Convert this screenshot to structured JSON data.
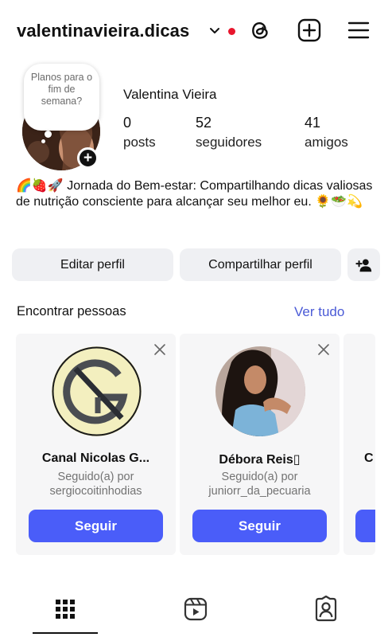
{
  "header": {
    "username": "valentinavieira.dicas",
    "icons": [
      "chevron-down-icon",
      "threads-icon",
      "new-post-icon",
      "menu-icon"
    ],
    "notification_dot_color": "#e8162d"
  },
  "profile": {
    "note": "Planos para o fim de semana?",
    "full_name": "Valentina Vieira",
    "stats": [
      {
        "value": "0",
        "label": "posts"
      },
      {
        "value": "52",
        "label": "seguidores"
      },
      {
        "value": "41",
        "label": "amigos"
      }
    ],
    "bio": "🌈🍓🚀 Jornada do Bem-estar: Compartilhando dicas valiosas de nutrição consciente para alcançar seu melhor eu. 🌻🥗💫"
  },
  "actions": {
    "edit_label": "Editar perfil",
    "share_label": "Compartilhar perfil"
  },
  "suggestions": {
    "title": "Encontrar pessoas",
    "see_all": "Ver tudo",
    "accent_color": "#4a5df9",
    "cards": [
      {
        "name": "Canal Nicolas G...",
        "followed_by_label": "Seguido(a) por",
        "followed_by_user": "sergiocoitinhodias",
        "button": "Seguir"
      },
      {
        "name": "Débora Reis▯",
        "followed_by_label": "Seguido(a) por",
        "followed_by_user": "juniorr_da_pecuaria",
        "button": "Seguir"
      },
      {
        "name": "C",
        "button": ""
      }
    ]
  },
  "tabs": {
    "items": [
      "grid-icon",
      "reels-icon",
      "tagged-icon"
    ],
    "active": "grid-icon"
  }
}
